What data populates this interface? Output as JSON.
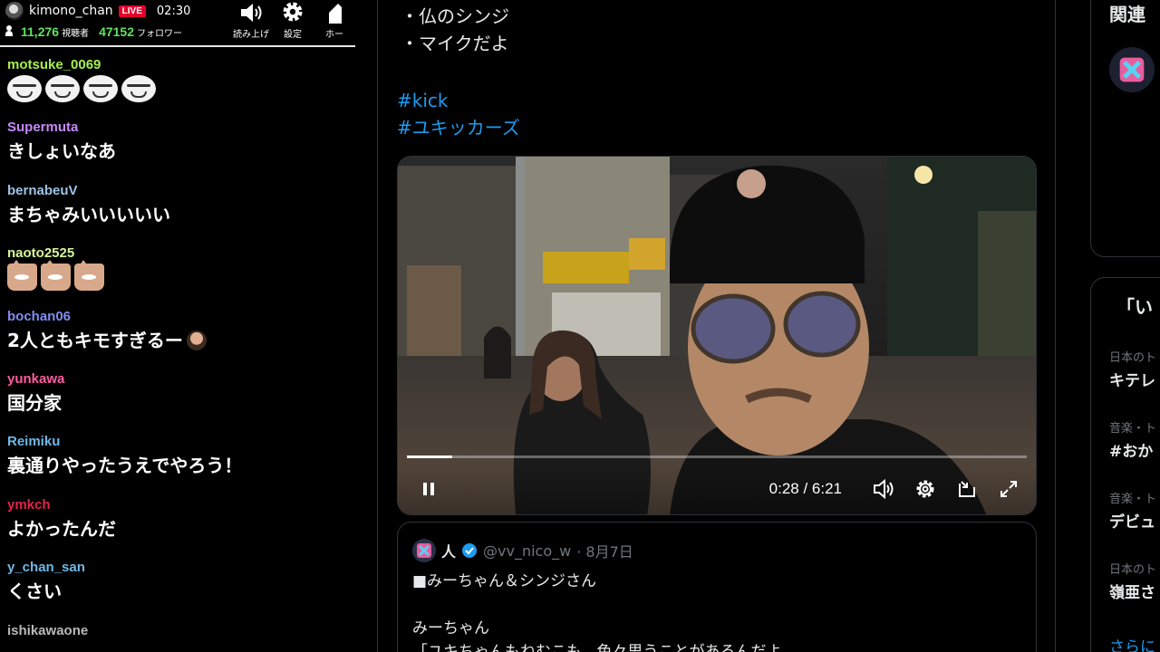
{
  "stream": {
    "channel_name": "kimono_chan",
    "live_label": "LIVE",
    "elapsed": "02:30",
    "viewers": "11,276",
    "viewers_label": "視聴者",
    "followers": "47152",
    "followers_label": "フォロワー",
    "tools": [
      {
        "icon": "speaker-icon",
        "label": "読み上げ"
      },
      {
        "icon": "gear-icon",
        "label": "設定"
      },
      {
        "icon": "home-icon",
        "label": "ホー"
      }
    ]
  },
  "chat": [
    {
      "user": "motsuke_0069",
      "color": "#a6ef4c",
      "text": "",
      "emotes": "face4"
    },
    {
      "user": "Supermuta",
      "color": "#c58af9",
      "text": "きしょいなあ"
    },
    {
      "user": "bernabeuV",
      "color": "#9cc3e6",
      "text": "まちゃみいいいいい"
    },
    {
      "user": "naoto2525",
      "color": "#d7f59a",
      "text": "",
      "emotes": "cat3"
    },
    {
      "user": "bochan06",
      "color": "#7e8ef0",
      "text": "2人ともキモすぎるー"
    },
    {
      "user": "yunkawa",
      "color": "#ff5aa0",
      "text": "国分家"
    },
    {
      "user": "Reimiku",
      "color": "#6fb7e6",
      "text": "裏通りやったうえでやろう！"
    },
    {
      "user": "ymkch",
      "color": "#e0244a",
      "text": "よかったんだ"
    },
    {
      "user": "y_chan_san",
      "color": "#6fb7e6",
      "text": "くさい"
    },
    {
      "user": "ishikawaone",
      "color": "#b9b9b9",
      "text": ""
    }
  ],
  "tweet": {
    "lines": [
      "・仏のシンジ",
      "・マイクだよ"
    ],
    "hashtags": [
      "#kick",
      "#ユキッカーズ"
    ]
  },
  "video": {
    "current_time": "0:28",
    "duration": "6:21",
    "time_display": "0:28 / 6:21",
    "progress": 0.0735
  },
  "quote": {
    "name": "人",
    "handle": "@vv_nico_w",
    "date": "· 8月7日",
    "body": [
      "■みーちゃん＆シンジさん",
      "",
      "みーちゃん",
      "「ユキちゃんもねむこも、色々思うことがあるんだよ"
    ]
  },
  "sidebar": {
    "title1": "関連",
    "title2": "「い",
    "trends": [
      {
        "sub": "日本のト",
        "name": "キテレ"
      },
      {
        "sub": "音楽・ト",
        "name": "#おか"
      },
      {
        "sub": "音楽・ト",
        "name": "デビュ"
      },
      {
        "sub": "日本のト",
        "name": "嶺亜さ"
      }
    ],
    "more": "さらに"
  }
}
